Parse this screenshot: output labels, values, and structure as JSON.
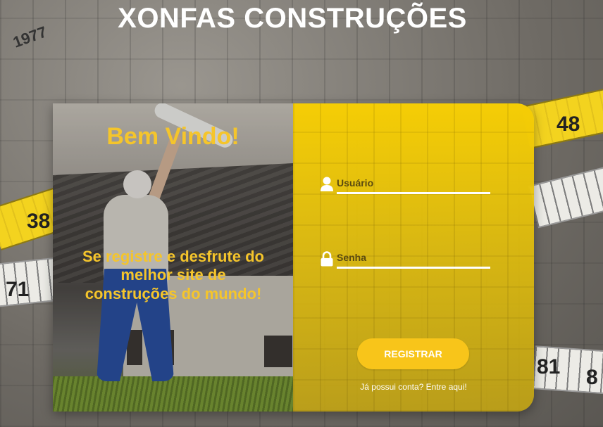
{
  "site_title": "XONFAS CONSTRUÇÕES",
  "background": {
    "tape_numbers": [
      "1977",
      "48",
      "38",
      "71",
      "81",
      "8"
    ]
  },
  "welcome_panel": {
    "heading": "Bem Vindo!",
    "tagline": "Se registre e desfrute do melhor site de construções do mundo!",
    "heading_color": "#f5c52b"
  },
  "form": {
    "username": {
      "placeholder": "Usuário",
      "value": "",
      "icon": "user-icon"
    },
    "password": {
      "placeholder": "Senha",
      "value": "",
      "icon": "lock-icon"
    },
    "register_label": "REGISTRAR",
    "login_link": "Já possui conta? Entre aqui!",
    "accent_color": "#f5cd05"
  }
}
